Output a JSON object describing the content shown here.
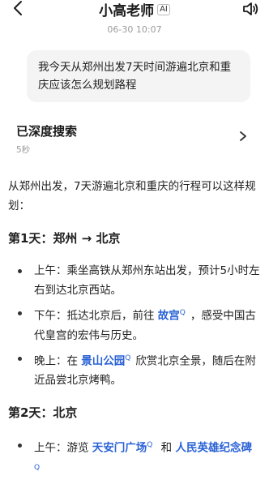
{
  "header": {
    "title": "小高老师",
    "ai_badge": "AI",
    "timestamp": "06-30 10:07"
  },
  "user_message": "我今天从郑州出发7天时间游遍北京和重庆应该怎么规划路程",
  "search": {
    "title": "已深度搜索",
    "duration": "5秒"
  },
  "answer": {
    "intro": "从郑州出发，7天游遍北京和重庆的行程可以这样规划：",
    "day1": {
      "heading": "第1天：郑州 → 北京",
      "morning": "上午：乘坐高铁从郑州东站出发，预计5小时左右到达北京西站。",
      "afternoon_pre": "下午：抵达北京后，前往 ",
      "afternoon_link": "故宫",
      "afternoon_post": "，感受中国古代皇宫的宏伟与历史。",
      "evening_pre": "晚上：在 ",
      "evening_link": "景山公园",
      "evening_post": "欣赏北京全景，随后在附近品尝北京烤鸭。"
    },
    "day2": {
      "heading": "第2天：北京",
      "morning_pre": "上午：游览 ",
      "morning_link1": "天安门广场",
      "morning_mid": " 和 ",
      "morning_link2": "人民英雄纪念碑"
    }
  },
  "colors": {
    "link": "#2a62d6",
    "bubble": "#f4f4f4",
    "muted": "#9a9a9a"
  }
}
